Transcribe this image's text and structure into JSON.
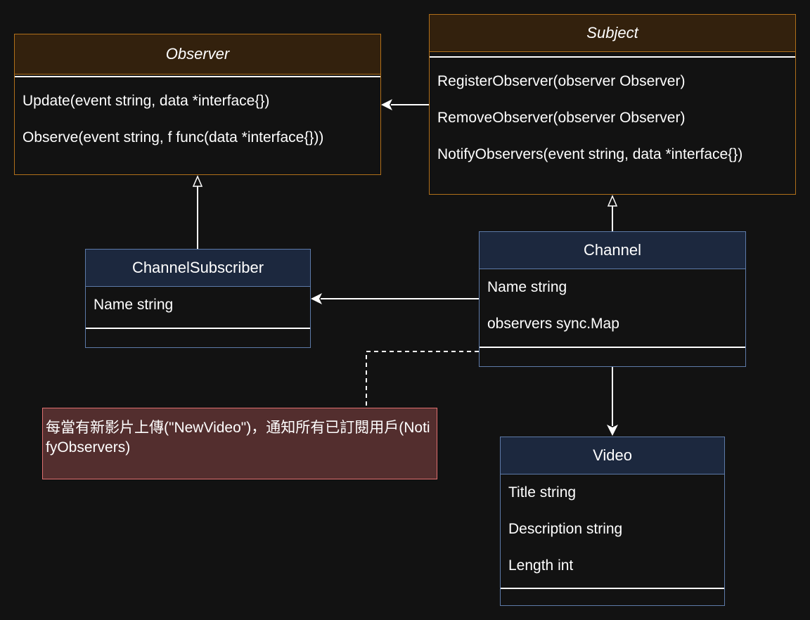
{
  "classes": {
    "observer": {
      "title": "Observer",
      "methods": [
        "Update(event string, data *interface{})",
        "Observe(event string, f func(data *interface{}))"
      ]
    },
    "subject": {
      "title": "Subject",
      "methods": [
        "RegisterObserver(observer Observer)",
        "RemoveObserver(observer Observer)",
        "NotifyObservers(event string, data *interface{})"
      ]
    },
    "channel_subscriber": {
      "title": "ChannelSubscriber",
      "fields": [
        "Name string"
      ]
    },
    "channel": {
      "title": "Channel",
      "fields": [
        "Name string",
        "observers sync.Map"
      ]
    },
    "video": {
      "title": "Video",
      "fields": [
        "Title string",
        "Description string",
        "Length int"
      ]
    }
  },
  "note": {
    "text": "每當有新影片上傳(\"NewVideo\")，通知所有已訂閱用戶(NotifyObservers)"
  },
  "colors": {
    "background": "#121212",
    "interface_border": "#b06f1a",
    "interface_header": "#33210d",
    "class_border": "#5d7aa8",
    "class_header": "#1c283e",
    "note_fill": "#532e2e",
    "note_border": "#e07070",
    "connector": "#ffffff"
  }
}
